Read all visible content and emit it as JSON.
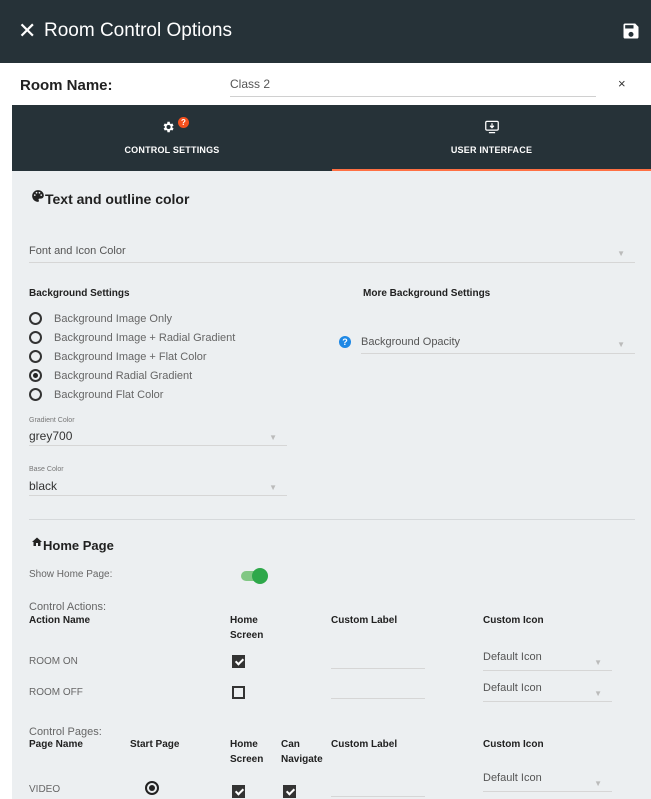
{
  "header": {
    "title": "Room Control Options",
    "close_icon": "✕"
  },
  "room": {
    "label": "Room Name:",
    "value": "Class 2",
    "clear": "×"
  },
  "tabs": [
    {
      "label": "CONTROL SETTINGS",
      "icon": "gear-icon",
      "badge": "?"
    },
    {
      "label": "USER INTERFACE",
      "icon": "screen-share-icon",
      "active": true
    }
  ],
  "text_color": {
    "heading": "Text and outline color",
    "font_icon_color": "Font and Icon Color"
  },
  "background": {
    "heading": "Background Settings",
    "options": [
      {
        "label": "Background Image Only",
        "selected": false
      },
      {
        "label": "Background Image + Radial Gradient",
        "selected": false
      },
      {
        "label": "Background Image + Flat Color",
        "selected": false
      },
      {
        "label": "Background Radial Gradient",
        "selected": true
      },
      {
        "label": "Background Flat Color",
        "selected": false
      }
    ],
    "gradient_label": "Gradient Color",
    "gradient_value": "grey700",
    "base_label": "Base Color",
    "base_value": "black",
    "more_heading": "More Background Settings",
    "opacity": "Background Opacity"
  },
  "home": {
    "heading": "Home Page",
    "show_label": "Show Home Page:",
    "show_on": true,
    "actions_label": "Control Actions:",
    "actions_cols": {
      "name": "Action Name",
      "home": "Home Screen",
      "custom_label": "Custom Label",
      "custom_icon": "Custom Icon"
    },
    "actions": [
      {
        "name": "ROOM ON",
        "home": true,
        "icon": "Default Icon"
      },
      {
        "name": "ROOM OFF",
        "home": false,
        "icon": "Default Icon"
      }
    ],
    "pages_label": "Control Pages:",
    "pages_cols": {
      "name": "Page Name",
      "start": "Start Page",
      "home": "Home Screen",
      "nav": "Can Navigate",
      "custom_label": "Custom Label",
      "custom_icon": "Custom Icon"
    },
    "pages": [
      {
        "name": "VIDEO",
        "start": true,
        "home": true,
        "nav": true,
        "icon": "Default Icon"
      }
    ]
  }
}
